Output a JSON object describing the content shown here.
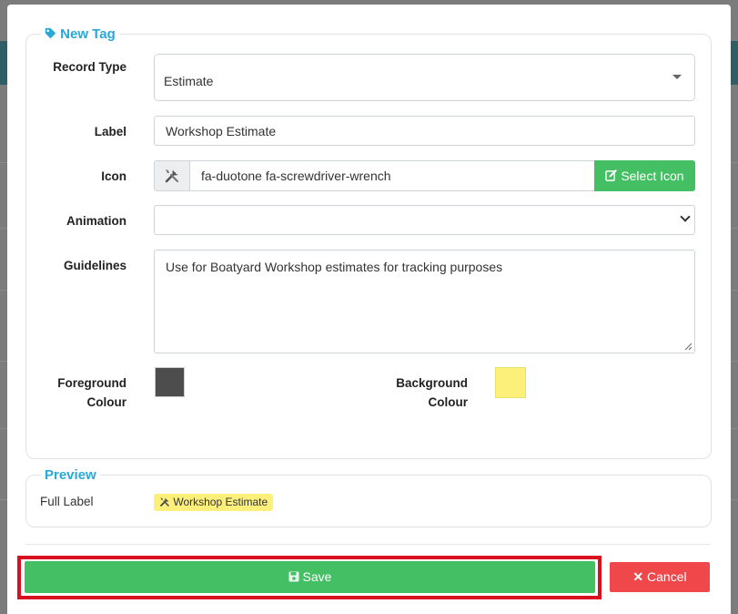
{
  "form": {
    "title": "New Tag",
    "record_type": {
      "label": "Record Type",
      "value": "Estimate"
    },
    "label_field": {
      "label": "Label",
      "value": "Workshop Estimate"
    },
    "icon_field": {
      "label": "Icon",
      "value": "fa-duotone fa-screwdriver-wrench",
      "button": "Select Icon",
      "icon": "screwdriver-wrench-icon"
    },
    "animation": {
      "label": "Animation",
      "value": ""
    },
    "guidelines": {
      "label": "Guidelines",
      "value": "Use for Boatyard Workshop estimates for tracking purposes"
    },
    "foreground": {
      "label_1": "Foreground",
      "label_2": "Colour",
      "color": "#4d4d4d"
    },
    "background": {
      "label_1": "Background",
      "label_2": "Colour",
      "color": "#fcf07a"
    }
  },
  "preview": {
    "title": "Preview",
    "full_label_caption": "Full Label",
    "tag_text": "Workshop Estimate",
    "tag_icon": "screwdriver-wrench-icon"
  },
  "actions": {
    "save": "Save",
    "cancel": "Cancel"
  },
  "colors": {
    "accent": "#29a8d8",
    "save_green": "#45bf63",
    "cancel_red": "#f0474a",
    "highlight_red": "#d9101f"
  }
}
